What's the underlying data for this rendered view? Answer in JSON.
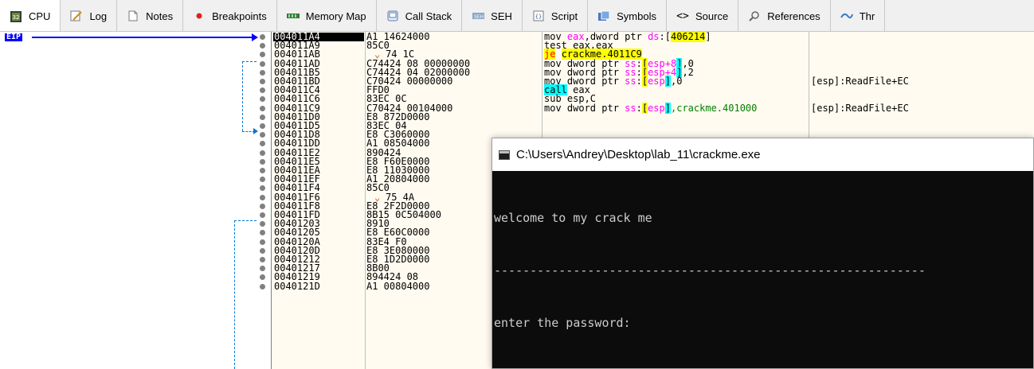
{
  "tabs": [
    {
      "label": "CPU",
      "icon": "cpu-icon",
      "active": true
    },
    {
      "label": "Log",
      "icon": "log-icon"
    },
    {
      "label": "Notes",
      "icon": "notes-icon"
    },
    {
      "label": "Breakpoints",
      "icon": "breakpoint-dot-icon"
    },
    {
      "label": "Memory Map",
      "icon": "memory-map-icon"
    },
    {
      "label": "Call Stack",
      "icon": "call-stack-icon"
    },
    {
      "label": "SEH",
      "icon": "seh-icon"
    },
    {
      "label": "Script",
      "icon": "script-icon"
    },
    {
      "label": "Symbols",
      "icon": "symbols-icon"
    },
    {
      "label": "Source",
      "icon": "source-icon"
    },
    {
      "label": "References",
      "icon": "references-icon"
    },
    {
      "label": "Thr",
      "icon": "threads-icon"
    }
  ],
  "eip_label": "EIP",
  "disasm": [
    {
      "addr": "004011A4",
      "bytes": "A1 14624000",
      "comment": ""
    },
    {
      "addr": "004011A9",
      "bytes": "85C0",
      "comment": ""
    },
    {
      "addr": "004011AB",
      "bytes": "74 1C",
      "comment": ""
    },
    {
      "addr": "004011AD",
      "bytes": "C74424 08 00000000",
      "comment": ""
    },
    {
      "addr": "004011B5",
      "bytes": "C74424 04 02000000",
      "comment": ""
    },
    {
      "addr": "004011BD",
      "bytes": "C70424 00000000",
      "comment": "[esp]:ReadFile+EC"
    },
    {
      "addr": "004011C4",
      "bytes": "FFD0",
      "comment": ""
    },
    {
      "addr": "004011C6",
      "bytes": "83EC 0C",
      "comment": ""
    },
    {
      "addr": "004011C9",
      "bytes": "C70424 00104000",
      "comment": "[esp]:ReadFile+EC"
    },
    {
      "addr": "004011D0",
      "bytes": "E8 872D0000",
      "comment": ""
    },
    {
      "addr": "004011D5",
      "bytes": "83EC 04",
      "comment": ""
    },
    {
      "addr": "004011D8",
      "bytes": "E8 C3060000",
      "comment": ""
    },
    {
      "addr": "004011DD",
      "bytes": "A1 08504000",
      "comment": ""
    },
    {
      "addr": "004011E2",
      "bytes": "890424",
      "comment": ""
    },
    {
      "addr": "004011E5",
      "bytes": "E8 F60E0000",
      "comment": ""
    },
    {
      "addr": "004011EA",
      "bytes": "E8 11030000",
      "comment": ""
    },
    {
      "addr": "004011EF",
      "bytes": "A1 20804000",
      "comment": ""
    },
    {
      "addr": "004011F4",
      "bytes": "85C0",
      "comment": ""
    },
    {
      "addr": "004011F6",
      "bytes": "75 4A",
      "comment": ""
    },
    {
      "addr": "004011F8",
      "bytes": "E8 2F2D0000",
      "comment": ""
    },
    {
      "addr": "004011FD",
      "bytes": "8B15 0C504000",
      "comment": ""
    },
    {
      "addr": "00401203",
      "bytes": "8910",
      "comment": ""
    },
    {
      "addr": "00401205",
      "bytes": "E8 E60C0000",
      "comment": ""
    },
    {
      "addr": "0040120A",
      "bytes": "83E4 F0",
      "comment": ""
    },
    {
      "addr": "0040120D",
      "bytes": "E8 3E080000",
      "comment": ""
    },
    {
      "addr": "00401212",
      "bytes": "E8 1D2D0000",
      "comment": ""
    },
    {
      "addr": "00401217",
      "bytes": "8B00",
      "comment": ""
    },
    {
      "addr": "00401219",
      "bytes": "894424 08",
      "comment": ""
    },
    {
      "addr": "0040121D",
      "bytes": "A1 00804000",
      "comment": ""
    }
  ],
  "instr": {
    "i0a": "mov ",
    "i0b": "eax",
    "i0c": ",dword ptr ",
    "i0d": "ds",
    "i0e": ":[",
    "i0f": "406214",
    "i0g": "]",
    "i1": "test eax,eax",
    "i2a": "je",
    "i2b": "crackme.4011C9",
    "i3a": "mov dword ptr ",
    "i3b": "ss",
    "i3c": ":",
    "i3d": "[",
    "i3e": "esp+8",
    "i3f": "]",
    "i3g": ",0",
    "i4a": "mov dword ptr ",
    "i4b": "ss",
    "i4c": ":",
    "i4d": "[",
    "i4e": "esp+4",
    "i4f": "]",
    "i4g": ",2",
    "i5a": "mov dword ptr ",
    "i5b": "ss",
    "i5c": ":",
    "i5d": "[",
    "i5e": "esp",
    "i5f": "]",
    "i5g": ",0",
    "i6a": "call",
    "i6b": " eax",
    "i7": "sub esp,C",
    "i8a": "mov dword ptr ",
    "i8b": "ss",
    "i8c": ":",
    "i8d": "[",
    "i8e": "esp",
    "i8f": "]",
    "i8g": ",crackme.401000"
  },
  "console": {
    "title": "C:\\Users\\Andrey\\Desktop\\lab_11\\crackme.exe",
    "line1": "welcome to my crack me",
    "line2": "------------------------------------------------------------",
    "line3": "enter the password:"
  }
}
